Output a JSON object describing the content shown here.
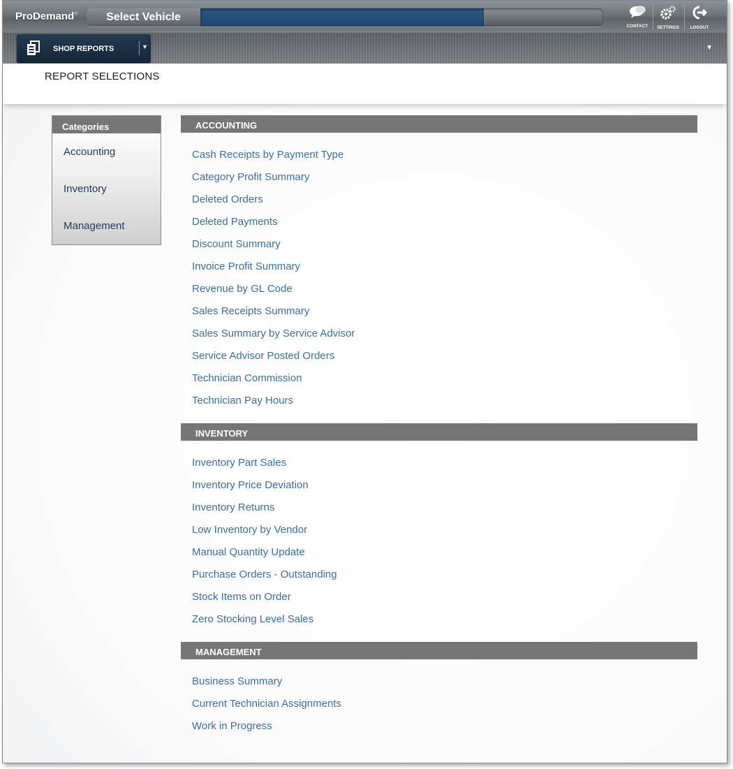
{
  "header": {
    "logo": "ProDemand",
    "logo_mark": "®",
    "select_vehicle_label": "Select Vehicle",
    "icons": [
      {
        "name": "contact-icon",
        "caption": "CONTACT"
      },
      {
        "name": "settings-icon",
        "caption": "SETTINGS"
      },
      {
        "name": "logout-icon",
        "caption": "LOGOUT"
      }
    ]
  },
  "subnav": {
    "module_label": "SHOP REPORTS"
  },
  "page": {
    "title": "REPORT SELECTIONS"
  },
  "categories": {
    "heading": "Categories",
    "items": [
      "Accounting",
      "Inventory",
      "Management"
    ]
  },
  "sections": [
    {
      "heading": "ACCOUNTING",
      "reports": [
        "Cash Receipts by Payment Type",
        "Category Profit Summary",
        "Deleted Orders",
        "Deleted Payments",
        "Discount Summary",
        "Invoice Profit Summary",
        "Revenue by GL Code",
        "Sales Receipts Summary",
        "Sales Summary by Service Advisor",
        "Service Advisor Posted Orders",
        "Technician Commission",
        "Technician Pay Hours"
      ]
    },
    {
      "heading": "INVENTORY",
      "reports": [
        "Inventory Part Sales",
        "Inventory Price Deviation",
        "Inventory Returns",
        "Low Inventory by Vendor",
        "Manual Quantity Update",
        "Purchase Orders - Outstanding",
        "Stock Items on Order",
        "Zero Stocking Level Sales"
      ]
    },
    {
      "heading": "MANAGEMENT",
      "reports": [
        "Business Summary",
        "Current Technician Assignments",
        "Work in Progress"
      ]
    }
  ]
}
